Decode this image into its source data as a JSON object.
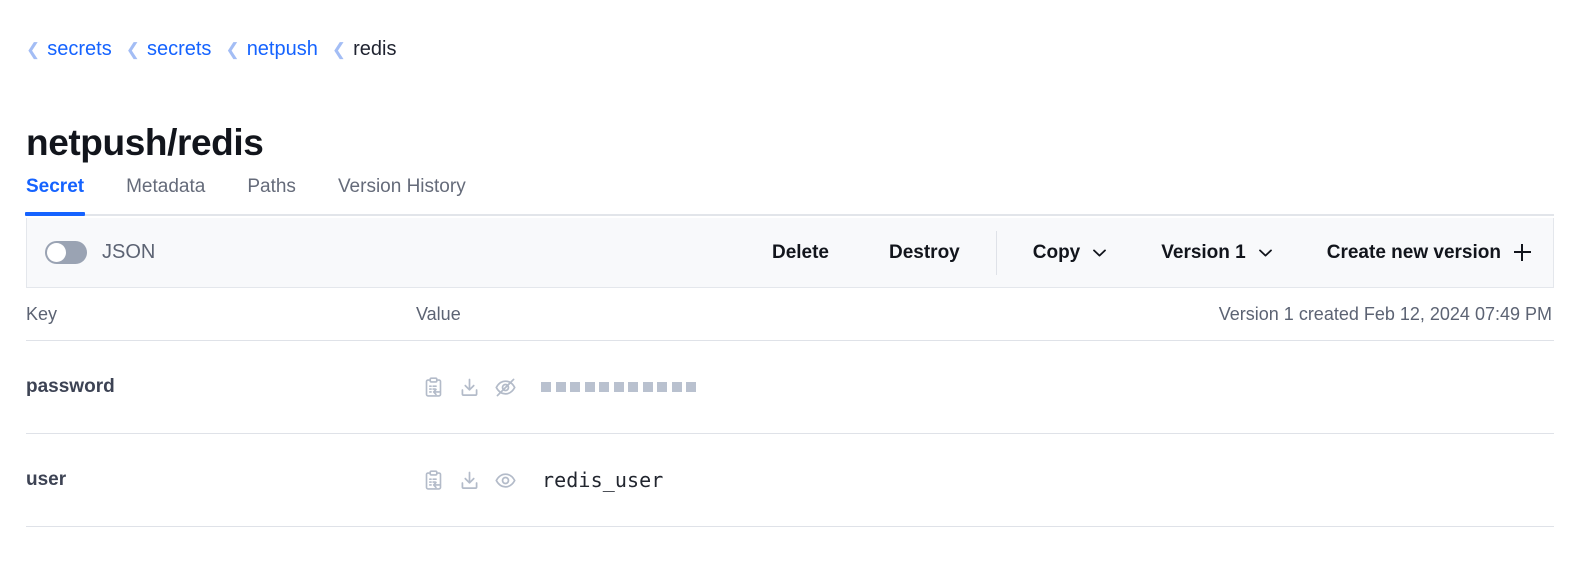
{
  "breadcrumb": [
    {
      "label": "secrets",
      "is_link": true
    },
    {
      "label": "secrets",
      "is_link": true
    },
    {
      "label": "netpush",
      "is_link": true
    },
    {
      "label": "redis",
      "is_link": false
    }
  ],
  "page_title": "netpush/redis",
  "tabs": [
    {
      "label": "Secret",
      "active": true
    },
    {
      "label": "Metadata",
      "active": false
    },
    {
      "label": "Paths",
      "active": false
    },
    {
      "label": "Version History",
      "active": false
    }
  ],
  "toolbar": {
    "json_toggle_label": "JSON",
    "json_toggle_on": false,
    "delete_label": "Delete",
    "destroy_label": "Destroy",
    "copy_label": "Copy",
    "version_label": "Version 1",
    "create_version_label": "Create new version"
  },
  "table": {
    "header": {
      "key": "Key",
      "value": "Value",
      "version_info": "Version 1 created Feb 12, 2024 07:49 PM"
    },
    "rows": [
      {
        "key": "password",
        "masked": true,
        "mask_count": 11,
        "value": "",
        "copy_icon": "clipboard-copy-icon",
        "download_icon": "download-icon",
        "visibility_icon": "eye-off-icon"
      },
      {
        "key": "user",
        "masked": false,
        "mask_count": 0,
        "value": "redis_user",
        "copy_icon": "clipboard-copy-icon",
        "download_icon": "download-icon",
        "visibility_icon": "eye-icon"
      }
    ]
  },
  "colors": {
    "accent": "#1563ff",
    "text_primary": "#12151c",
    "text_muted": "#5c6373",
    "icon_muted": "#b3bbc9",
    "toolbar_bg": "#f8f9fb",
    "border": "#dfe2e8",
    "mask_square": "#b9c1cf"
  }
}
